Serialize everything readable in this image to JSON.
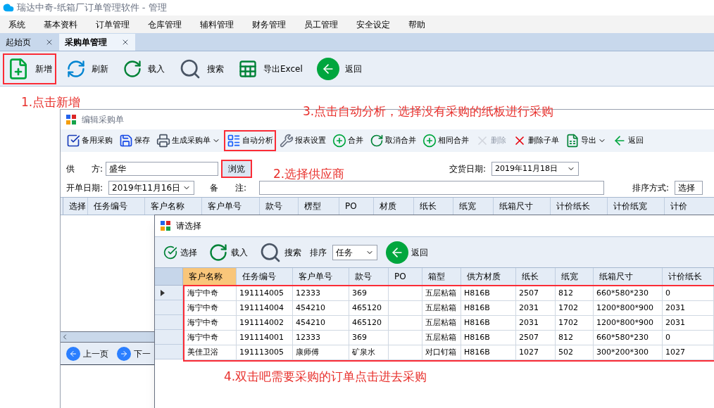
{
  "window": {
    "title": "瑞达中奇-纸箱厂订单管理软件 - 管理"
  },
  "menu": [
    "系统",
    "基本资料",
    "订单管理",
    "仓库管理",
    "辅料管理",
    "财务管理",
    "员工管理",
    "安全设定",
    "帮助"
  ],
  "tabs": [
    {
      "label": "起始页",
      "selected": false
    },
    {
      "label": "采购单管理",
      "selected": true
    }
  ],
  "toolbar": [
    {
      "label": "新增",
      "highlighted": true
    },
    {
      "label": "刷新",
      "highlighted": false
    },
    {
      "label": "载入",
      "highlighted": false
    },
    {
      "label": "搜索",
      "highlighted": false
    },
    {
      "label": "导出Excel",
      "highlighted": false
    },
    {
      "label": "返回",
      "highlighted": false
    }
  ],
  "annotations": [
    "1.点击新增",
    "3.点击自动分析，选择没有采购的纸板进行采购",
    "2.选择供应商",
    "4.双击吧需要采购的订单点击进去采购"
  ],
  "edit_dialog": {
    "title": "编辑采购单",
    "toolbar": [
      {
        "label": "备用采购",
        "kind": "button",
        "disabled": false,
        "highlighted": false
      },
      {
        "label": "保存",
        "kind": "button",
        "disabled": false,
        "highlighted": false
      },
      {
        "label": "生成采购单",
        "kind": "dropdown",
        "disabled": false,
        "highlighted": false
      },
      {
        "label": "自动分析",
        "kind": "button",
        "disabled": false,
        "highlighted": true
      },
      {
        "label": "报表设置",
        "kind": "button",
        "disabled": false,
        "highlighted": false
      },
      {
        "label": "合并",
        "kind": "button",
        "disabled": false,
        "highlighted": false
      },
      {
        "label": "取消合并",
        "kind": "button",
        "disabled": false,
        "highlighted": false
      },
      {
        "label": "相同合并",
        "kind": "button",
        "disabled": false,
        "highlighted": false
      },
      {
        "label": "删除",
        "kind": "button",
        "disabled": true,
        "highlighted": false
      },
      {
        "label": "删除子单",
        "kind": "button",
        "disabled": false,
        "highlighted": false
      },
      {
        "label": "导出",
        "kind": "dropdown",
        "disabled": false,
        "highlighted": false
      },
      {
        "label": "返回",
        "kind": "button",
        "disabled": false,
        "highlighted": false
      }
    ],
    "supplier": {
      "label": "供　　方:",
      "value": "盛华",
      "browse": "浏览",
      "browse_highlighted": true
    },
    "delivery_date": {
      "label": "交货日期:",
      "value": "2019年11月18日"
    },
    "open_date": {
      "label": "开单日期:",
      "value": "2019年11月16日"
    },
    "remark": {
      "label": "备　　注:"
    },
    "sort": {
      "label": "排序方式:",
      "value": "选择"
    },
    "columns": [
      "选择",
      "任务编号",
      "客户名称",
      "客户单号",
      "款号",
      "楞型",
      "PO",
      "材质",
      "纸长",
      "纸宽",
      "纸箱尺寸",
      "计价纸长",
      "计价纸宽",
      "计价"
    ],
    "pager": [
      "上一页",
      "下一"
    ]
  },
  "select_dialog": {
    "title": "请选择",
    "toolbar": [
      "选择",
      "载入",
      "搜索"
    ],
    "sort": {
      "label": "排序",
      "value": "任务"
    },
    "back": "返回",
    "columns": [
      {
        "label": "客户名称",
        "selected": true
      },
      {
        "label": "任务编号",
        "selected": false
      },
      {
        "label": "客户单号",
        "selected": false
      },
      {
        "label": "款号",
        "selected": false
      },
      {
        "label": "PO",
        "selected": false
      },
      {
        "label": "箱型",
        "selected": false
      },
      {
        "label": "供方材质",
        "selected": false
      },
      {
        "label": "纸长",
        "selected": false
      },
      {
        "label": "纸宽",
        "selected": false
      },
      {
        "label": "纸箱尺寸",
        "selected": false
      },
      {
        "label": "计价纸长",
        "selected": false
      }
    ],
    "rows_highlighted": true,
    "rows": [
      {
        "current": true,
        "cells": [
          "海宁中奇",
          "191114005",
          "12333",
          "369",
          "",
          "五层粘箱",
          "H816B",
          "2507",
          "812",
          "660*580*230",
          "0"
        ]
      },
      {
        "current": false,
        "cells": [
          "海宁中奇",
          "191114004",
          "454210",
          "465120",
          "",
          "五层粘箱",
          "H816B",
          "2031",
          "1702",
          "1200*800*900",
          "2031"
        ]
      },
      {
        "current": false,
        "cells": [
          "海宁中奇",
          "191114002",
          "454210",
          "465120",
          "",
          "五层粘箱",
          "H816B",
          "2031",
          "1702",
          "1200*800*900",
          "2031"
        ]
      },
      {
        "current": false,
        "cells": [
          "海宁中奇",
          "191114001",
          "12333",
          "369",
          "",
          "五层粘箱",
          "H816B",
          "2507",
          "812",
          "660*580*230",
          "0"
        ]
      },
      {
        "current": false,
        "cells": [
          "美佳卫浴",
          "191113005",
          "康师傅",
          "矿泉水",
          "",
          "对口钉箱",
          "H816B",
          "1027",
          "502",
          "300*200*300",
          "1027"
        ]
      }
    ]
  }
}
